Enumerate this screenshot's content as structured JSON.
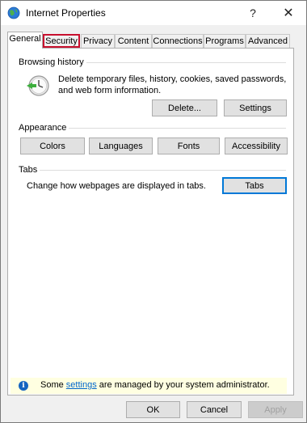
{
  "window": {
    "title": "Internet Properties",
    "help_label": "?",
    "close_label": "✕"
  },
  "tabs": [
    {
      "label": "General"
    },
    {
      "label": "Security"
    },
    {
      "label": "Privacy"
    },
    {
      "label": "Content"
    },
    {
      "label": "Connections"
    },
    {
      "label": "Programs"
    },
    {
      "label": "Advanced"
    }
  ],
  "browsing_history": {
    "heading": "Browsing history",
    "description_line1": "Delete temporary files, history, cookies, saved passwords,",
    "description_line2": "and web form information.",
    "delete_label": "Delete...",
    "settings_label": "Settings"
  },
  "appearance": {
    "heading": "Appearance",
    "colors_label": "Colors",
    "languages_label": "Languages",
    "fonts_label": "Fonts",
    "accessibility_label": "Accessibility"
  },
  "tabs_group": {
    "heading": "Tabs",
    "description": "Change how webpages are displayed in tabs.",
    "tabs_button_label": "Tabs"
  },
  "info": {
    "icon_label": "i",
    "prefix": "Some ",
    "link": "settings",
    "suffix": " are managed by your system administrator."
  },
  "footer": {
    "ok_label": "OK",
    "cancel_label": "Cancel",
    "apply_label": "Apply"
  },
  "colors": {
    "highlight": "#c8102e",
    "link": "#0066cc",
    "info_bg": "#ffffe1"
  }
}
